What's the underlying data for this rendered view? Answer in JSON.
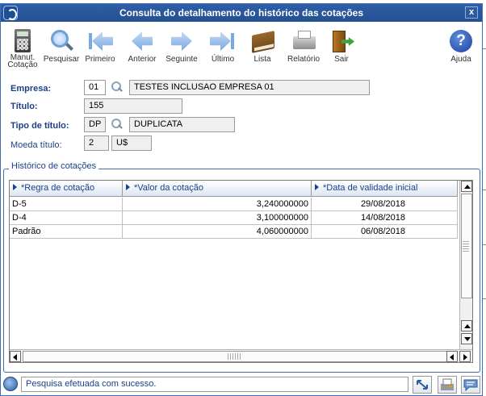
{
  "window": {
    "title": "Consulta do detalhamento do histórico das cotações",
    "close_label": "x"
  },
  "toolbar": [
    {
      "label": "Manut. Cotação",
      "icon": "calculator-icon"
    },
    {
      "label": "Pesquisar",
      "icon": "search-icon"
    },
    {
      "label": "Primeiro",
      "icon": "first-icon"
    },
    {
      "label": "Anterior",
      "icon": "previous-icon"
    },
    {
      "label": "Seguinte",
      "icon": "next-icon"
    },
    {
      "label": "Último",
      "icon": "last-icon"
    },
    {
      "label": "Lista",
      "icon": "book-icon"
    },
    {
      "label": "Relatório",
      "icon": "printer-icon"
    },
    {
      "label": "Sair",
      "icon": "exit-door-icon"
    },
    {
      "label": "Ajuda",
      "icon": "help-icon"
    }
  ],
  "form": {
    "empresa": {
      "label": "Empresa:",
      "code": "01",
      "description": "TESTES INCLUSAO EMPRESA 01"
    },
    "titulo": {
      "label": "Título:",
      "value": "155"
    },
    "tipo_titulo": {
      "label": "Tipo de título:",
      "code": "DP",
      "description": "DUPLICATA"
    },
    "moeda_titulo": {
      "label": "Moeda título:",
      "code": "2",
      "symbol": "U$"
    }
  },
  "history": {
    "group_title": "Histórico de cotações",
    "columns": [
      "*Regra de cotação",
      "*Valor da cotação",
      "*Data de validade inicial"
    ],
    "rows": [
      [
        "D-5",
        "3,240000000",
        "29/08/2018"
      ],
      [
        "D-4",
        "3,100000000",
        "14/08/2018"
      ],
      [
        "Padrão",
        "4,060000000",
        "06/08/2018"
      ]
    ]
  },
  "status": {
    "message": "Pesquisa efetuada com sucesso."
  },
  "colors": {
    "titlebar": "#2f5ea8",
    "label_blue": "#1b3f8b",
    "border_blue": "#3e6db5"
  }
}
